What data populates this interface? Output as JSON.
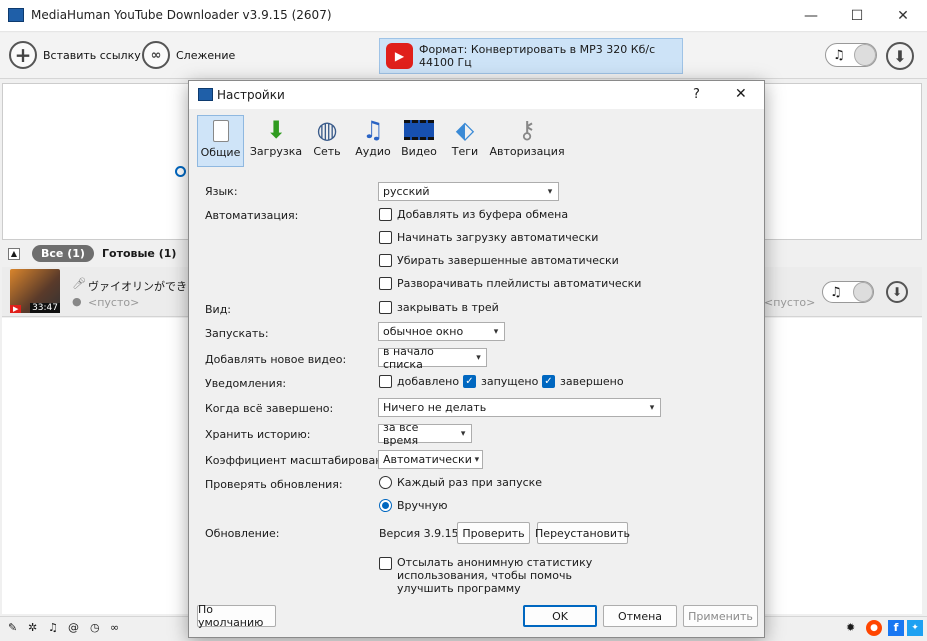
{
  "window": {
    "title": "MediaHuman YouTube Downloader v3.9.15 (2607)",
    "minimize": "—",
    "maximize": "☐",
    "close": "✕"
  },
  "toolbar": {
    "paste_label": "Вставить ссылку",
    "tracking_label": "Слежение",
    "format_label": "Формат: Конвертировать в MP3 320 Кб/с 44100 Гц",
    "accent": "#e0201b"
  },
  "filters": {
    "all": "Все (1)",
    "done": "Готовые (1)"
  },
  "item": {
    "title": "ヴァイオリンができるまで。",
    "subtitle": "<пусто>",
    "duration": "33:47",
    "right_placeholder": "<пусто>"
  },
  "dialog": {
    "title": "Настройки",
    "help": "?",
    "close": "✕",
    "tabs": [
      {
        "label": "Общие",
        "icon": "switch-icon"
      },
      {
        "label": "Загрузка",
        "icon": "download-arrow-icon"
      },
      {
        "label": "Сеть",
        "icon": "globe-icon"
      },
      {
        "label": "Аудио",
        "icon": "music-note-icon"
      },
      {
        "label": "Видео",
        "icon": "film-icon"
      },
      {
        "label": "Теги",
        "icon": "tag-icon"
      },
      {
        "label": "Авторизация",
        "icon": "keys-icon"
      }
    ],
    "language": {
      "label": "Язык:",
      "value": "русский"
    },
    "automation": {
      "label": "Автоматизация:",
      "options": [
        {
          "label": "Добавлять из буфера обмена",
          "checked": false
        },
        {
          "label": "Начинать загрузку автоматически",
          "checked": false
        },
        {
          "label": "Убирать завершенные автоматически",
          "checked": false
        },
        {
          "label": "Разворачивать плейлисты автоматически",
          "checked": false
        }
      ]
    },
    "view": {
      "label": "Вид:",
      "option": "закрывать в трей",
      "checked": false
    },
    "launch": {
      "label": "Запускать:",
      "value": "обычное окно"
    },
    "add_video": {
      "label": "Добавлять новое видео:",
      "value": "в начало списка"
    },
    "notifications": {
      "label": "Уведомления:",
      "options": [
        {
          "label": "добавлено",
          "checked": false
        },
        {
          "label": "запущено",
          "checked": true
        },
        {
          "label": "завершено",
          "checked": true
        }
      ]
    },
    "when_done": {
      "label": "Когда всё завершено:",
      "value": "Ничего не делать"
    },
    "history": {
      "label": "Хранить историю:",
      "value": "за все время"
    },
    "scale": {
      "label": "Коэффициент масштабирования:",
      "value": "Автоматически"
    },
    "check_updates": {
      "label": "Проверять обновления:",
      "options": [
        {
          "label": "Каждый раз при запуске",
          "selected": false
        },
        {
          "label": "Вручную",
          "selected": true
        }
      ]
    },
    "update": {
      "label": "Обновление:",
      "version": "Версия 3.9.15",
      "check_button": "Проверить",
      "reinstall_button": "Переустановить"
    },
    "stats": {
      "line1": "Отсылать анонимную статистику",
      "line2": "использования, чтобы помочь",
      "line3": "улучшить программу",
      "checked": false
    },
    "buttons": {
      "defaults": "По умолчанию",
      "ok": "OK",
      "cancel": "Отмена",
      "apply": "Применить"
    }
  }
}
